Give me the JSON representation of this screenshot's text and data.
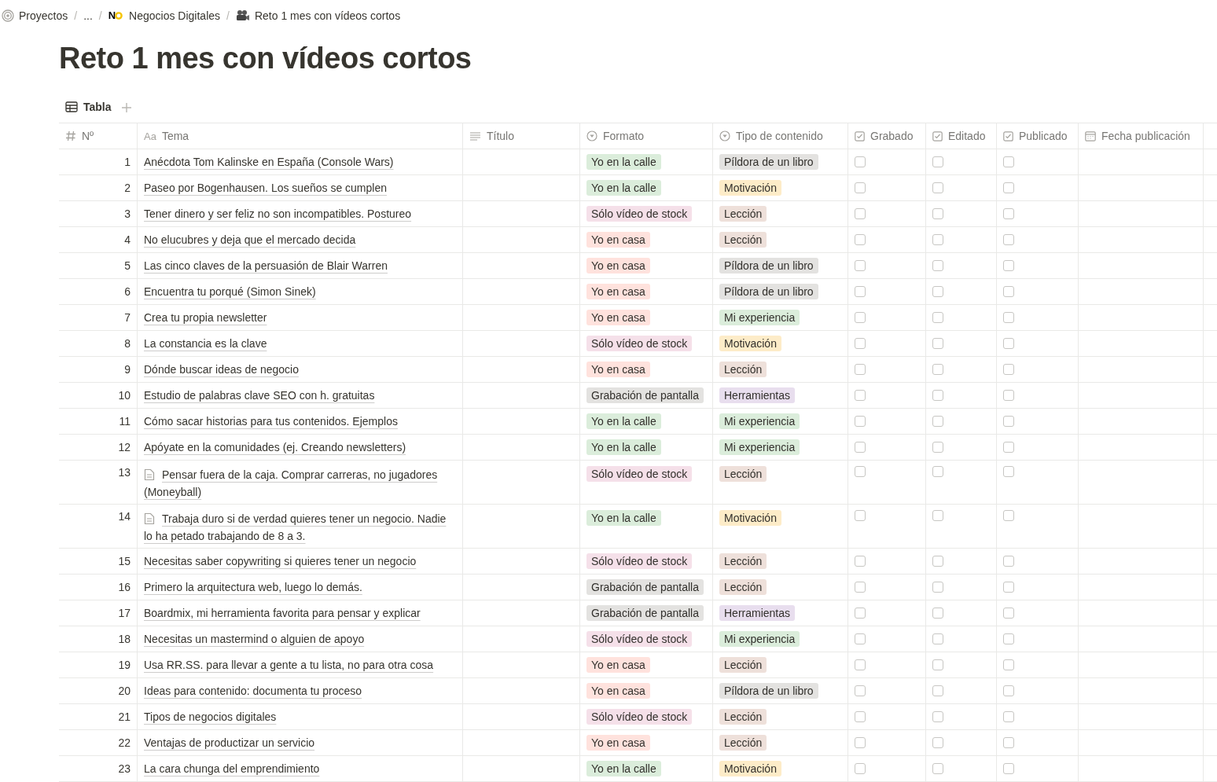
{
  "breadcrumb": [
    {
      "kind": "workspace",
      "label": "Proyectos"
    },
    {
      "kind": "ellipsis",
      "sep": "/",
      "label": "..."
    },
    {
      "kind": "logo",
      "sep": "/",
      "logo": "N",
      "label": "Negocios Digitales"
    },
    {
      "kind": "camera",
      "sep": "/",
      "label": "Reto 1 mes con vídeos cortos"
    }
  ],
  "title": "Reto 1 mes con vídeos cortos",
  "views": [
    {
      "label": "Tabla",
      "selected": true
    }
  ],
  "columns": [
    {
      "kind": "number",
      "label": "Nº"
    },
    {
      "kind": "title",
      "icon_text": "Aa",
      "label": "Tema"
    },
    {
      "kind": "text",
      "label": "Título"
    },
    {
      "kind": "select",
      "label": "Formato"
    },
    {
      "kind": "select",
      "label": "Tipo de contenido"
    },
    {
      "kind": "checkbox",
      "label": "Grabado"
    },
    {
      "kind": "checkbox",
      "label": "Editado"
    },
    {
      "kind": "checkbox",
      "label": "Publicado"
    },
    {
      "kind": "date",
      "label": "Fecha publicación"
    }
  ],
  "rows": [
    {
      "n": "1",
      "tema": "Anécdota Tom Kalinske en España (Console Wars)",
      "page_icon": false,
      "formato": {
        "label": "Yo en la calle",
        "color": "#dbeddb"
      },
      "tipo": {
        "label": "Píldora de un libro",
        "color": "#e3e2e0"
      },
      "grabado": false,
      "editado": false,
      "publicado": false
    },
    {
      "n": "2",
      "tema": "Paseo por Bogenhausen. Los sueños se cumplen",
      "page_icon": false,
      "formato": {
        "label": "Yo en la calle",
        "color": "#dbeddb"
      },
      "tipo": {
        "label": "Motivación",
        "color": "#fdecc8"
      },
      "grabado": false,
      "editado": false,
      "publicado": false
    },
    {
      "n": "3",
      "tema": "Tener dinero y ser feliz no son incompatibles. Postureo",
      "page_icon": false,
      "formato": {
        "label": "Sólo vídeo de stock",
        "color": "#f5e0e9"
      },
      "tipo": {
        "label": "Lección",
        "color": "#eee0da"
      },
      "grabado": false,
      "editado": false,
      "publicado": false
    },
    {
      "n": "4",
      "tema": "No elucubres y deja que el mercado decida",
      "page_icon": false,
      "formato": {
        "label": "Yo en casa",
        "color": "#ffe2dd"
      },
      "tipo": {
        "label": "Lección",
        "color": "#eee0da"
      },
      "grabado": false,
      "editado": false,
      "publicado": false
    },
    {
      "n": "5",
      "tema": "Las cinco claves de la persuasión de Blair Warren",
      "page_icon": false,
      "formato": {
        "label": "Yo en casa",
        "color": "#ffe2dd"
      },
      "tipo": {
        "label": "Píldora de un libro",
        "color": "#e3e2e0"
      },
      "grabado": false,
      "editado": false,
      "publicado": false
    },
    {
      "n": "6",
      "tema": "Encuentra tu porqué (Simon Sinek)",
      "page_icon": false,
      "formato": {
        "label": "Yo en casa",
        "color": "#ffe2dd"
      },
      "tipo": {
        "label": "Píldora de un libro",
        "color": "#e3e2e0"
      },
      "grabado": false,
      "editado": false,
      "publicado": false
    },
    {
      "n": "7",
      "tema": "Crea tu propia newsletter",
      "page_icon": false,
      "formato": {
        "label": "Yo en casa",
        "color": "#ffe2dd"
      },
      "tipo": {
        "label": "Mi experiencia",
        "color": "#dbeddb"
      },
      "grabado": false,
      "editado": false,
      "publicado": false
    },
    {
      "n": "8",
      "tema": "La constancia es la clave",
      "page_icon": false,
      "formato": {
        "label": "Sólo vídeo de stock",
        "color": "#f5e0e9"
      },
      "tipo": {
        "label": "Motivación",
        "color": "#fdecc8"
      },
      "grabado": false,
      "editado": false,
      "publicado": false
    },
    {
      "n": "9",
      "tema": "Dónde buscar ideas de negocio",
      "page_icon": false,
      "formato": {
        "label": "Yo en casa",
        "color": "#ffe2dd"
      },
      "tipo": {
        "label": "Lección",
        "color": "#eee0da"
      },
      "grabado": false,
      "editado": false,
      "publicado": false
    },
    {
      "n": "10",
      "tema": "Estudio de palabras clave SEO con h. gratuitas",
      "page_icon": false,
      "formato": {
        "label": "Grabación de pantalla",
        "color": "#e3e2e0"
      },
      "tipo": {
        "label": "Herramientas",
        "color": "#e8deee"
      },
      "grabado": false,
      "editado": false,
      "publicado": false
    },
    {
      "n": "11",
      "tema": "Cómo sacar historias para tus contenidos. Ejemplos",
      "page_icon": false,
      "formato": {
        "label": "Yo en la calle",
        "color": "#dbeddb"
      },
      "tipo": {
        "label": "Mi experiencia",
        "color": "#dbeddb"
      },
      "grabado": false,
      "editado": false,
      "publicado": false
    },
    {
      "n": "12",
      "tema": "Apóyate en la comunidades (ej. Creando newsletters)",
      "page_icon": false,
      "formato": {
        "label": "Yo en la calle",
        "color": "#dbeddb"
      },
      "tipo": {
        "label": "Mi experiencia",
        "color": "#dbeddb"
      },
      "grabado": false,
      "editado": false,
      "publicado": false
    },
    {
      "n": "13",
      "tema": "Pensar fuera de la caja. Comprar carreras, no jugadores (Moneyball)",
      "page_icon": true,
      "formato": {
        "label": "Sólo vídeo de stock",
        "color": "#f5e0e9"
      },
      "tipo": {
        "label": "Lección",
        "color": "#eee0da"
      },
      "grabado": false,
      "editado": false,
      "publicado": false
    },
    {
      "n": "14",
      "tema": "Trabaja duro si de verdad quieres tener un negocio. Nadie lo ha petado trabajando de 8 a 3.",
      "page_icon": true,
      "formato": {
        "label": "Yo en la calle",
        "color": "#dbeddb"
      },
      "tipo": {
        "label": "Motivación",
        "color": "#fdecc8"
      },
      "grabado": false,
      "editado": false,
      "publicado": false
    },
    {
      "n": "15",
      "tema": "Necesitas saber copywriting si quieres tener un negocio",
      "page_icon": false,
      "formato": {
        "label": "Sólo vídeo de stock",
        "color": "#f5e0e9"
      },
      "tipo": {
        "label": "Lección",
        "color": "#eee0da"
      },
      "grabado": false,
      "editado": false,
      "publicado": false
    },
    {
      "n": "16",
      "tema": "Primero la arquitectura web, luego lo demás.",
      "page_icon": false,
      "formato": {
        "label": "Grabación de pantalla",
        "color": "#e3e2e0"
      },
      "tipo": {
        "label": "Lección",
        "color": "#eee0da"
      },
      "grabado": false,
      "editado": false,
      "publicado": false
    },
    {
      "n": "17",
      "tema": "Boardmix, mi herramienta favorita para pensar y explicar",
      "page_icon": false,
      "formato": {
        "label": "Grabación de pantalla",
        "color": "#e3e2e0"
      },
      "tipo": {
        "label": "Herramientas",
        "color": "#e8deee"
      },
      "grabado": false,
      "editado": false,
      "publicado": false
    },
    {
      "n": "18",
      "tema": "Necesitas un mastermind o alguien de apoyo",
      "page_icon": false,
      "formato": {
        "label": "Sólo vídeo de stock",
        "color": "#f5e0e9"
      },
      "tipo": {
        "label": "Mi experiencia",
        "color": "#dbeddb"
      },
      "grabado": false,
      "editado": false,
      "publicado": false
    },
    {
      "n": "19",
      "tema": "Usa RR.SS. para llevar a gente a tu lista, no para otra cosa",
      "page_icon": false,
      "formato": {
        "label": "Yo en casa",
        "color": "#ffe2dd"
      },
      "tipo": {
        "label": "Lección",
        "color": "#eee0da"
      },
      "grabado": false,
      "editado": false,
      "publicado": false
    },
    {
      "n": "20",
      "tema": "Ideas para contenido: documenta tu proceso",
      "page_icon": false,
      "formato": {
        "label": "Yo en casa",
        "color": "#ffe2dd"
      },
      "tipo": {
        "label": "Píldora de un libro",
        "color": "#e3e2e0"
      },
      "grabado": false,
      "editado": false,
      "publicado": false
    },
    {
      "n": "21",
      "tema": "Tipos de negocios digitales",
      "page_icon": false,
      "formato": {
        "label": "Sólo vídeo de stock",
        "color": "#f5e0e9"
      },
      "tipo": {
        "label": "Lección",
        "color": "#eee0da"
      },
      "grabado": false,
      "editado": false,
      "publicado": false
    },
    {
      "n": "22",
      "tema": "Ventajas de productizar un servicio",
      "page_icon": false,
      "formato": {
        "label": "Yo en casa",
        "color": "#ffe2dd"
      },
      "tipo": {
        "label": "Lección",
        "color": "#eee0da"
      },
      "grabado": false,
      "editado": false,
      "publicado": false
    },
    {
      "n": "23",
      "tema": "La cara chunga del emprendimiento",
      "page_icon": false,
      "formato": {
        "label": "Yo en la calle",
        "color": "#dbeddb"
      },
      "tipo": {
        "label": "Motivación",
        "color": "#fdecc8"
      },
      "grabado": false,
      "editado": false,
      "publicado": false
    }
  ]
}
